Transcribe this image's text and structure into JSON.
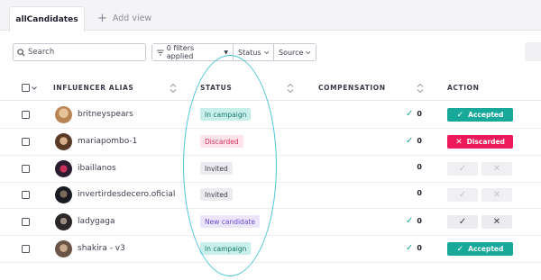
{
  "tabs": {
    "active_label": "allCandidates",
    "add_view_label": "Add view"
  },
  "toolbar": {
    "search_placeholder": "Search",
    "filters_label": "0 filters applied",
    "status_label": "Status",
    "source_label": "Source"
  },
  "table": {
    "columns": {
      "alias": "INFLUENCER ALIAS",
      "status": "STATUS",
      "compensation": "COMPENSATION",
      "action": "ACTION"
    },
    "rows": [
      {
        "alias": "britneyspears",
        "status": "In campaign",
        "status_kind": "campaign",
        "compensation": "0",
        "comp_check": true,
        "action": "Accepted",
        "action_kind": "accepted"
      },
      {
        "alias": "mariapombo-1",
        "status": "Discarded",
        "status_kind": "discarded",
        "compensation": "0",
        "comp_check": true,
        "action": "Discarded",
        "action_kind": "discarded"
      },
      {
        "alias": "ibaillanos",
        "status": "Invited",
        "status_kind": "invited",
        "compensation": "0",
        "comp_check": false,
        "action": "",
        "action_kind": "disabled"
      },
      {
        "alias": "invertirdesdecero.oficial",
        "status": "Invited",
        "status_kind": "invited",
        "compensation": "0",
        "comp_check": false,
        "action": "",
        "action_kind": "disabled"
      },
      {
        "alias": "ladygaga",
        "status": "New candidate",
        "status_kind": "new",
        "compensation": "0",
        "comp_check": true,
        "action": "",
        "action_kind": "pending"
      },
      {
        "alias": "shakira - v3",
        "status": "In campaign",
        "status_kind": "campaign",
        "compensation": "0",
        "comp_check": true,
        "action": "Accepted",
        "action_kind": "accepted"
      }
    ]
  },
  "colors": {
    "accent_teal": "#18a99a",
    "discard_pink": "#ec1a5a",
    "annotation_circle": "#4fc5d6"
  }
}
